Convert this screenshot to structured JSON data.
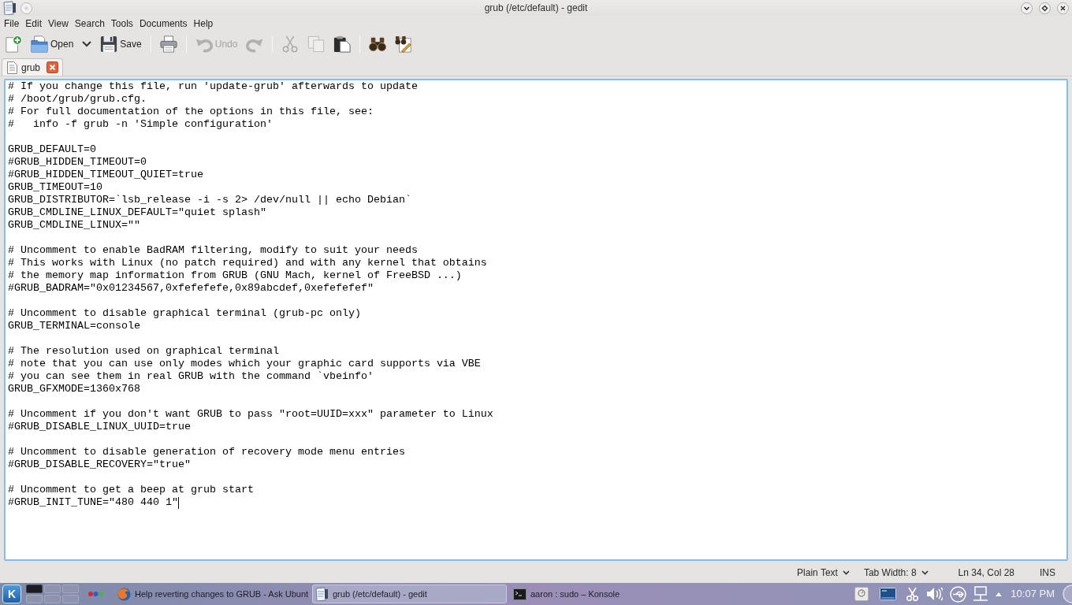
{
  "window": {
    "title": "grub (/etc/default) - gedit"
  },
  "menu": [
    "File",
    "Edit",
    "View",
    "Search",
    "Tools",
    "Documents",
    "Help"
  ],
  "toolbar": [
    [
      {
        "kind": "new",
        "disabled": false
      },
      {
        "kind": "open",
        "label": "Open",
        "disabled": false
      },
      {
        "kind": "recent",
        "disabled": false
      },
      {
        "kind": "save",
        "label": "Save",
        "disabled": false
      }
    ],
    [
      {
        "kind": "print",
        "disabled": false
      }
    ],
    [
      {
        "kind": "undo",
        "label": "Undo",
        "disabled": true
      },
      {
        "kind": "redo",
        "disabled": true
      }
    ],
    [
      {
        "kind": "cut",
        "disabled": true
      },
      {
        "kind": "copy",
        "disabled": true
      },
      {
        "kind": "paste",
        "disabled": false
      }
    ],
    [
      {
        "kind": "find",
        "disabled": false
      },
      {
        "kind": "replace",
        "disabled": false
      }
    ]
  ],
  "tabs": [
    {
      "label": "grub",
      "selected": true
    }
  ],
  "editor": {
    "blocks": [
      [
        "# If you change this file, run 'update-grub' afterwards to update",
        "# /boot/grub/grub.cfg.",
        "# For full documentation of the options in this file, see:",
        "#   info -f grub -n 'Simple configuration'"
      ],
      [
        "GRUB_DEFAULT=0",
        "#GRUB_HIDDEN_TIMEOUT=0",
        "#GRUB_HIDDEN_TIMEOUT_QUIET=true",
        "GRUB_TIMEOUT=10",
        "GRUB_DISTRIBUTOR=`lsb_release -i -s 2> /dev/null || echo Debian`",
        "GRUB_CMDLINE_LINUX_DEFAULT=\"quiet splash\"",
        "GRUB_CMDLINE_LINUX=\"\""
      ],
      [
        "# Uncomment to enable BadRAM filtering, modify to suit your needs",
        "# This works with Linux (no patch required) and with any kernel that obtains",
        "# the memory map information from GRUB (GNU Mach, kernel of FreeBSD ...)",
        "#GRUB_BADRAM=\"0x01234567,0xfefefefe,0x89abcdef,0xefefefef\""
      ],
      [
        "# Uncomment to disable graphical terminal (grub-pc only)",
        "GRUB_TERMINAL=console"
      ],
      [
        "# The resolution used on graphical terminal",
        "# note that you can use only modes which your graphic card supports via VBE",
        "# you can see them in real GRUB with the command `vbeinfo'",
        "GRUB_GFXMODE=1360x768"
      ],
      [
        "# Uncomment if you don't want GRUB to pass \"root=UUID=xxx\" parameter to Linux",
        "#GRUB_DISABLE_LINUX_UUID=true"
      ],
      [
        "# Uncomment to disable generation of recovery mode menu entries",
        "#GRUB_DISABLE_RECOVERY=\"true\""
      ],
      [
        "# Uncomment to get a beep at grub start",
        "#GRUB_INIT_TUNE=\"480 440 1\""
      ]
    ],
    "cursor_at_end": true
  },
  "status_bar": {
    "language": "Plain Text",
    "tab_width": "Tab Width: 8",
    "position": "Ln 34, Col 28",
    "mode": "INS"
  },
  "taskbar": {
    "start_button": {
      "label": "K"
    },
    "desktops": [
      {
        "selected": true
      },
      {
        "selected": false
      },
      {
        "selected": false
      },
      {
        "selected": false
      },
      {
        "selected": false
      },
      {
        "selected": false
      }
    ],
    "tasks": [
      {
        "kind": "browser",
        "label": "Help reverting changes to GRUB - Ask Ubunt",
        "selected": false
      },
      {
        "kind": "editor",
        "label": "grub (/etc/default) - gedit",
        "selected": true
      },
      {
        "kind": "terminal",
        "label": "aaron : sudo – Konsole",
        "selected": false
      }
    ],
    "clock": "10:07 PM"
  }
}
